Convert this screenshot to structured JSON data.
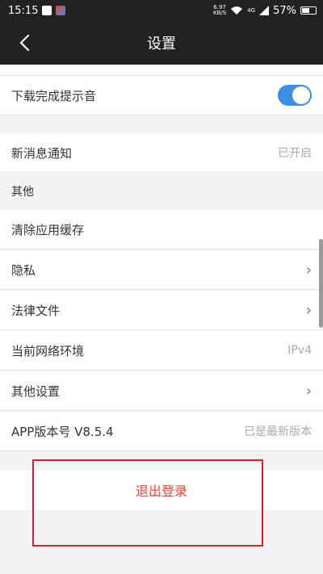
{
  "status_bar": {
    "time": "15:15",
    "net_speed_value": "6.97",
    "net_speed_unit": "KB/S",
    "signal_label": "4G",
    "battery": "57%",
    "battery_level": 0.57
  },
  "header": {
    "title": "设置"
  },
  "settings": {
    "download_sound": {
      "label": "下载完成提示音",
      "enabled": true
    },
    "notifications": {
      "label": "新消息通知",
      "value": "已开启"
    }
  },
  "other_section": {
    "header": "其他",
    "items": [
      {
        "label": "清除应用缓存",
        "value": ""
      },
      {
        "label": "隐私",
        "value": ""
      },
      {
        "label": "法律文件",
        "value": ""
      },
      {
        "label": "当前网络环境",
        "value": "IPv4"
      },
      {
        "label": "其他设置",
        "value": ""
      },
      {
        "label": "APP版本号 V8.5.4",
        "value": "已是最新版本"
      }
    ]
  },
  "logout": {
    "label": "退出登录"
  },
  "colors": {
    "accent_red": "#e8412f",
    "toggle_blue": "#3d8fe3",
    "highlight": "#d9202a"
  }
}
